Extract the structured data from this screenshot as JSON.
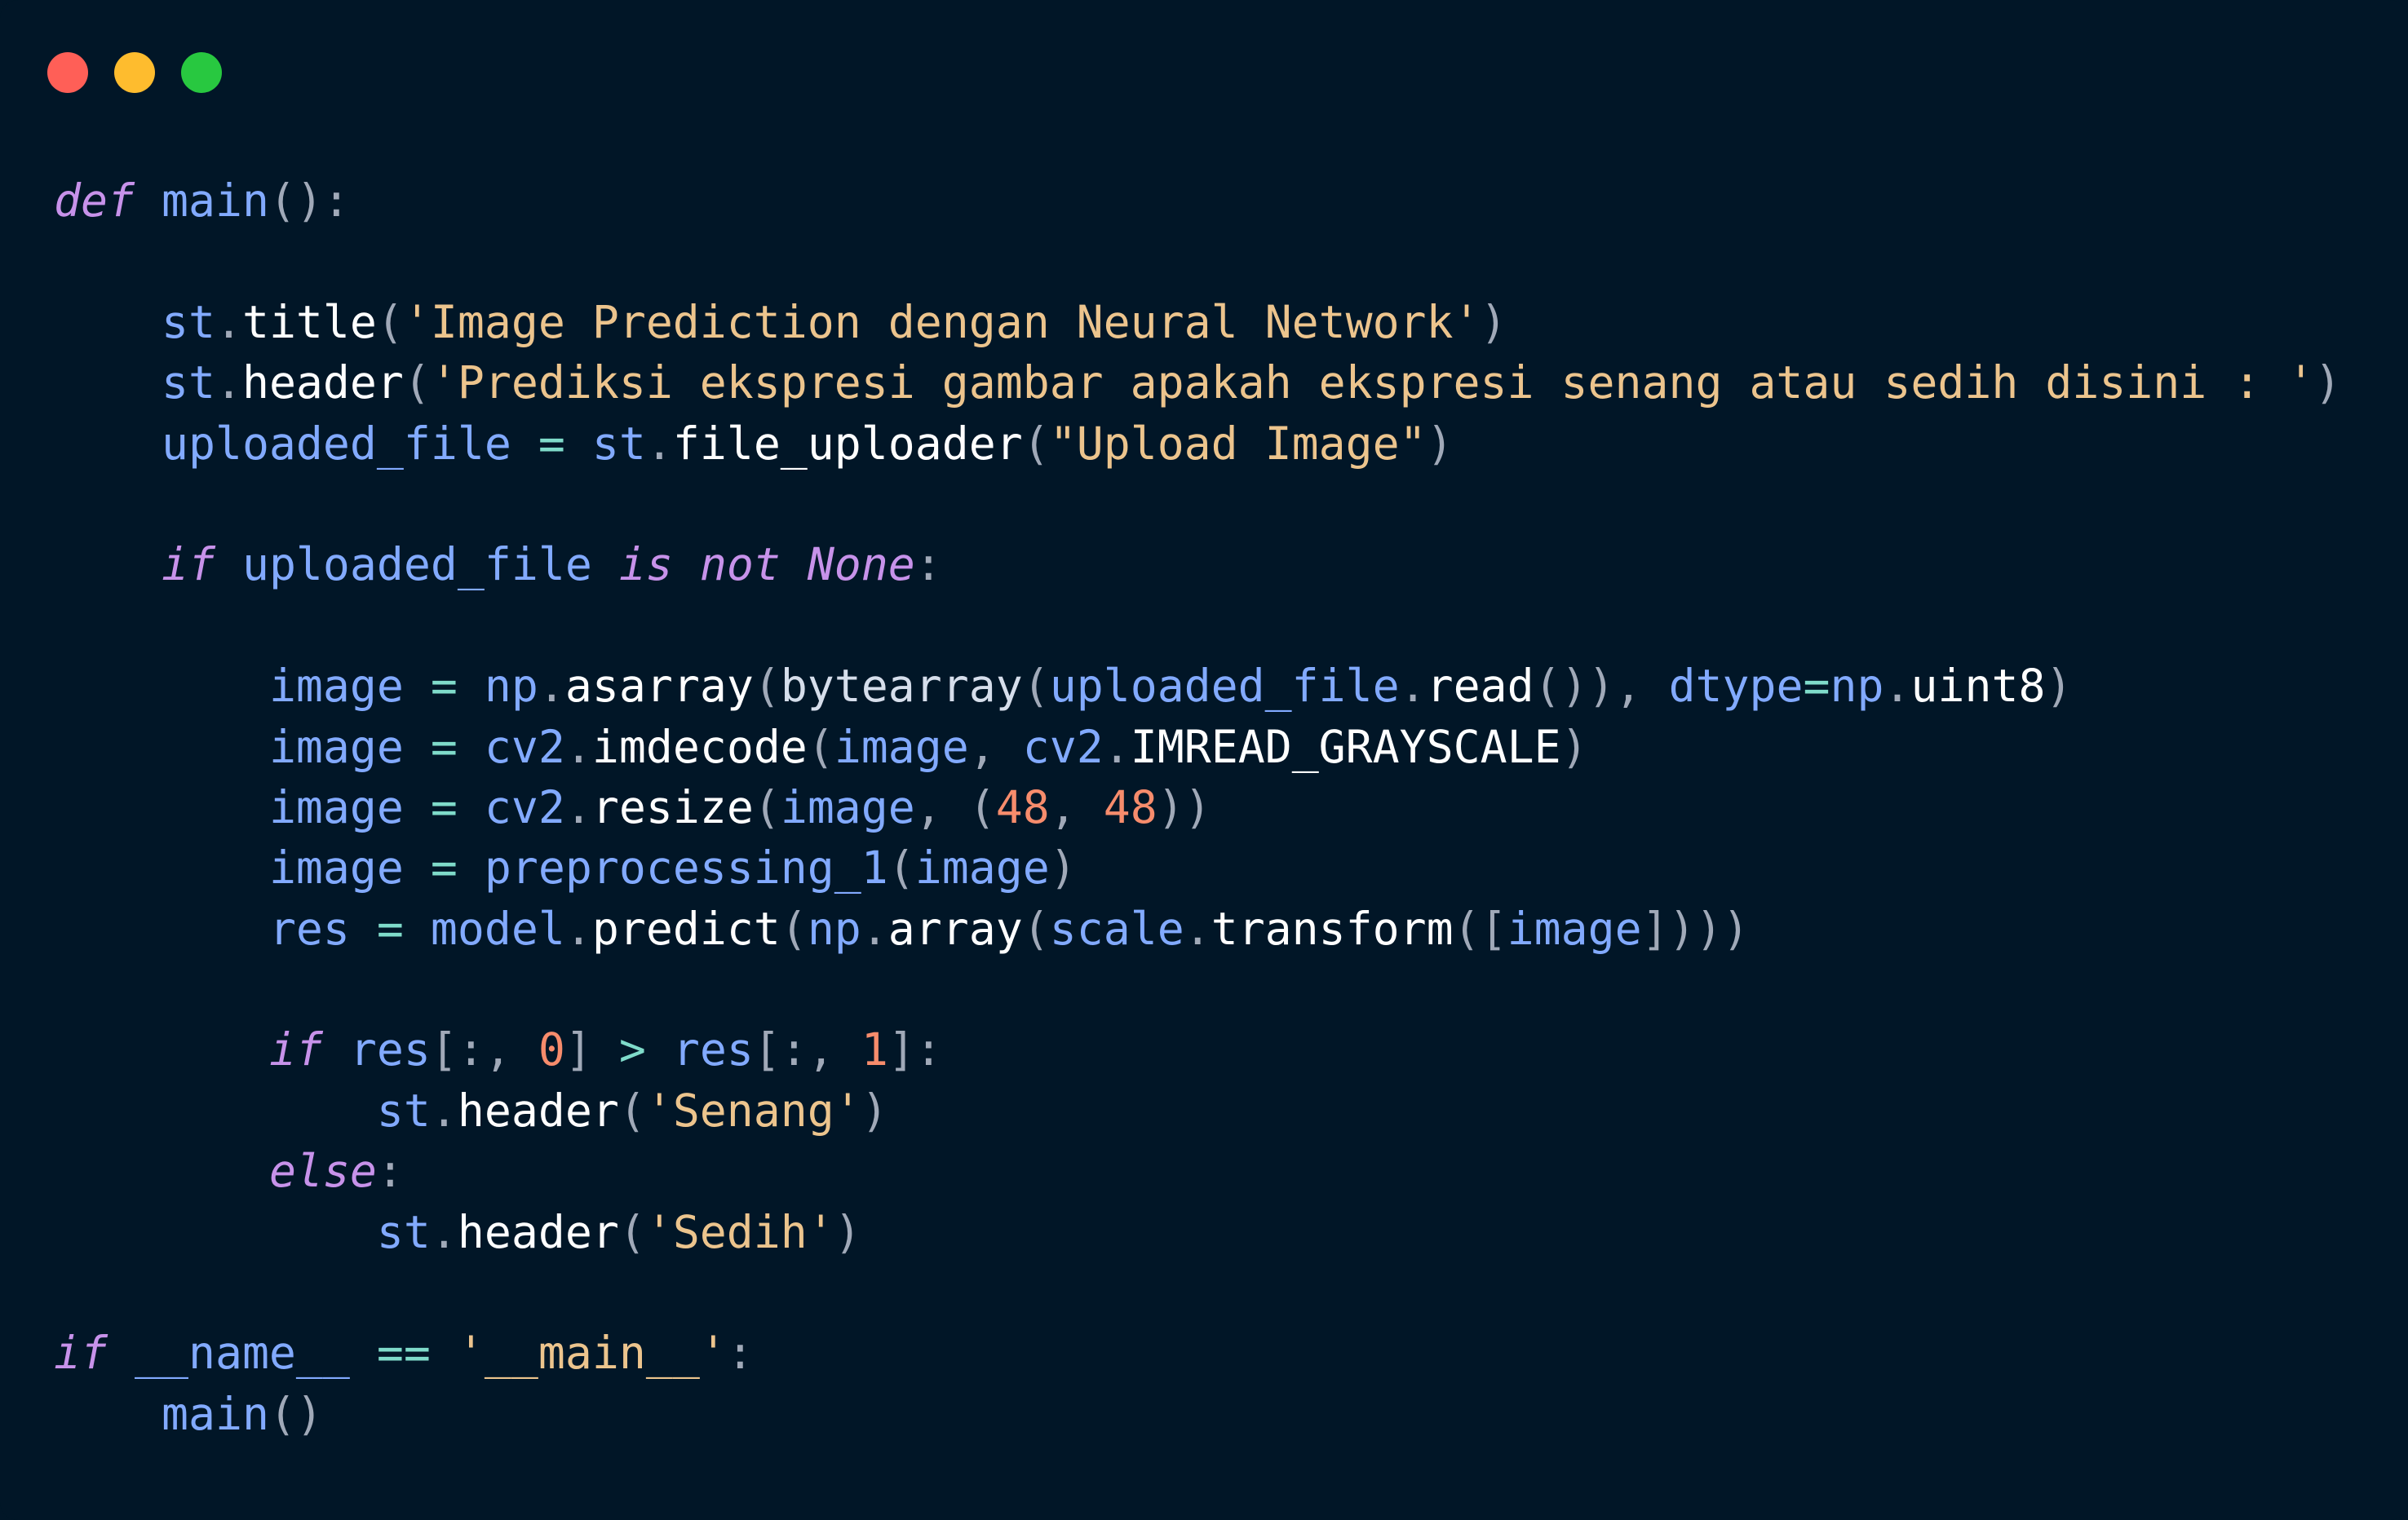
{
  "window": {
    "controls": [
      {
        "name": "close",
        "color": "#ff5f57"
      },
      {
        "name": "minimize",
        "color": "#febc2e"
      },
      {
        "name": "maximize",
        "color": "#28c840"
      }
    ]
  },
  "theme": {
    "background": "#011627",
    "keyword": "#c792ea",
    "identifier": "#82aaff",
    "call": "#ffffff",
    "string": "#ecc48d",
    "number": "#f78c6c",
    "operator": "#7fdbca",
    "punctuation": "#a0a9b8"
  },
  "code": {
    "lines": [
      [
        [
          "kw",
          "def"
        ],
        [
          "plain",
          " "
        ],
        [
          "fn",
          "main"
        ],
        [
          "punc",
          "():"
        ]
      ],
      [],
      [
        [
          "plain",
          "    "
        ],
        [
          "var",
          "st"
        ],
        [
          "punc",
          "."
        ],
        [
          "call",
          "title"
        ],
        [
          "punc",
          "("
        ],
        [
          "str",
          "'Image Prediction dengan Neural Network'"
        ],
        [
          "punc",
          ")"
        ]
      ],
      [
        [
          "plain",
          "    "
        ],
        [
          "var",
          "st"
        ],
        [
          "punc",
          "."
        ],
        [
          "call",
          "header"
        ],
        [
          "punc",
          "("
        ],
        [
          "str",
          "'Prediksi ekspresi gambar apakah ekspresi senang atau sedih disini : '"
        ],
        [
          "punc",
          ")"
        ]
      ],
      [
        [
          "plain",
          "    "
        ],
        [
          "var",
          "uploaded_file"
        ],
        [
          "plain",
          " "
        ],
        [
          "op",
          "="
        ],
        [
          "plain",
          " "
        ],
        [
          "var",
          "st"
        ],
        [
          "punc",
          "."
        ],
        [
          "call",
          "file_uploader"
        ],
        [
          "punc",
          "("
        ],
        [
          "str",
          "\"Upload Image\""
        ],
        [
          "punc",
          ")"
        ]
      ],
      [],
      [
        [
          "plain",
          "    "
        ],
        [
          "kw",
          "if"
        ],
        [
          "plain",
          " "
        ],
        [
          "var",
          "uploaded_file"
        ],
        [
          "plain",
          " "
        ],
        [
          "kw",
          "is"
        ],
        [
          "plain",
          " "
        ],
        [
          "kw",
          "not"
        ],
        [
          "plain",
          " "
        ],
        [
          "kw",
          "None"
        ],
        [
          "punc",
          ":"
        ]
      ],
      [],
      [
        [
          "plain",
          "        "
        ],
        [
          "var",
          "image"
        ],
        [
          "plain",
          " "
        ],
        [
          "op",
          "="
        ],
        [
          "plain",
          " "
        ],
        [
          "var",
          "np"
        ],
        [
          "punc",
          "."
        ],
        [
          "call",
          "asarray"
        ],
        [
          "punc",
          "("
        ],
        [
          "plain",
          "bytearray"
        ],
        [
          "punc",
          "("
        ],
        [
          "var",
          "uploaded_file"
        ],
        [
          "punc",
          "."
        ],
        [
          "call",
          "read"
        ],
        [
          "punc",
          "()),"
        ],
        [
          "plain",
          " "
        ],
        [
          "var",
          "dtype"
        ],
        [
          "op",
          "="
        ],
        [
          "var",
          "np"
        ],
        [
          "punc",
          "."
        ],
        [
          "call",
          "uint8"
        ],
        [
          "punc",
          ")"
        ]
      ],
      [
        [
          "plain",
          "        "
        ],
        [
          "var",
          "image"
        ],
        [
          "plain",
          " "
        ],
        [
          "op",
          "="
        ],
        [
          "plain",
          " "
        ],
        [
          "var",
          "cv2"
        ],
        [
          "punc",
          "."
        ],
        [
          "call",
          "imdecode"
        ],
        [
          "punc",
          "("
        ],
        [
          "var",
          "image"
        ],
        [
          "punc",
          ","
        ],
        [
          "plain",
          " "
        ],
        [
          "var",
          "cv2"
        ],
        [
          "punc",
          "."
        ],
        [
          "call",
          "IMREAD_GRAYSCALE"
        ],
        [
          "punc",
          ")"
        ]
      ],
      [
        [
          "plain",
          "        "
        ],
        [
          "var",
          "image"
        ],
        [
          "plain",
          " "
        ],
        [
          "op",
          "="
        ],
        [
          "plain",
          " "
        ],
        [
          "var",
          "cv2"
        ],
        [
          "punc",
          "."
        ],
        [
          "call",
          "resize"
        ],
        [
          "punc",
          "("
        ],
        [
          "var",
          "image"
        ],
        [
          "punc",
          ","
        ],
        [
          "plain",
          " "
        ],
        [
          "punc",
          "("
        ],
        [
          "num",
          "48"
        ],
        [
          "punc",
          ","
        ],
        [
          "plain",
          " "
        ],
        [
          "num",
          "48"
        ],
        [
          "punc",
          "))"
        ]
      ],
      [
        [
          "plain",
          "        "
        ],
        [
          "var",
          "image"
        ],
        [
          "plain",
          " "
        ],
        [
          "op",
          "="
        ],
        [
          "plain",
          " "
        ],
        [
          "fn",
          "preprocessing_1"
        ],
        [
          "punc",
          "("
        ],
        [
          "var",
          "image"
        ],
        [
          "punc",
          ")"
        ]
      ],
      [
        [
          "plain",
          "        "
        ],
        [
          "var",
          "res"
        ],
        [
          "plain",
          " "
        ],
        [
          "op",
          "="
        ],
        [
          "plain",
          " "
        ],
        [
          "var",
          "model"
        ],
        [
          "punc",
          "."
        ],
        [
          "call",
          "predict"
        ],
        [
          "punc",
          "("
        ],
        [
          "var",
          "np"
        ],
        [
          "punc",
          "."
        ],
        [
          "call",
          "array"
        ],
        [
          "punc",
          "("
        ],
        [
          "var",
          "scale"
        ],
        [
          "punc",
          "."
        ],
        [
          "call",
          "transform"
        ],
        [
          "punc",
          "(["
        ],
        [
          "var",
          "image"
        ],
        [
          "punc",
          "])))"
        ]
      ],
      [],
      [
        [
          "plain",
          "        "
        ],
        [
          "kw",
          "if"
        ],
        [
          "plain",
          " "
        ],
        [
          "var",
          "res"
        ],
        [
          "punc",
          "[:,"
        ],
        [
          "plain",
          " "
        ],
        [
          "num",
          "0"
        ],
        [
          "punc",
          "]"
        ],
        [
          "plain",
          " "
        ],
        [
          "op",
          ">"
        ],
        [
          "plain",
          " "
        ],
        [
          "var",
          "res"
        ],
        [
          "punc",
          "[:,"
        ],
        [
          "plain",
          " "
        ],
        [
          "num",
          "1"
        ],
        [
          "punc",
          "]:"
        ]
      ],
      [
        [
          "plain",
          "            "
        ],
        [
          "var",
          "st"
        ],
        [
          "punc",
          "."
        ],
        [
          "call",
          "header"
        ],
        [
          "punc",
          "("
        ],
        [
          "str",
          "'Senang'"
        ],
        [
          "punc",
          ")"
        ]
      ],
      [
        [
          "plain",
          "        "
        ],
        [
          "kw",
          "else"
        ],
        [
          "punc",
          ":"
        ]
      ],
      [
        [
          "plain",
          "            "
        ],
        [
          "var",
          "st"
        ],
        [
          "punc",
          "."
        ],
        [
          "call",
          "header"
        ],
        [
          "punc",
          "("
        ],
        [
          "str",
          "'Sedih'"
        ],
        [
          "punc",
          ")"
        ]
      ],
      [],
      [
        [
          "kw",
          "if"
        ],
        [
          "plain",
          " "
        ],
        [
          "dunder",
          "__name__"
        ],
        [
          "plain",
          " "
        ],
        [
          "op",
          "=="
        ],
        [
          "plain",
          " "
        ],
        [
          "str",
          "'__main__'"
        ],
        [
          "punc",
          ":"
        ]
      ],
      [
        [
          "plain",
          "    "
        ],
        [
          "fn",
          "main"
        ],
        [
          "punc",
          "()"
        ]
      ]
    ]
  }
}
